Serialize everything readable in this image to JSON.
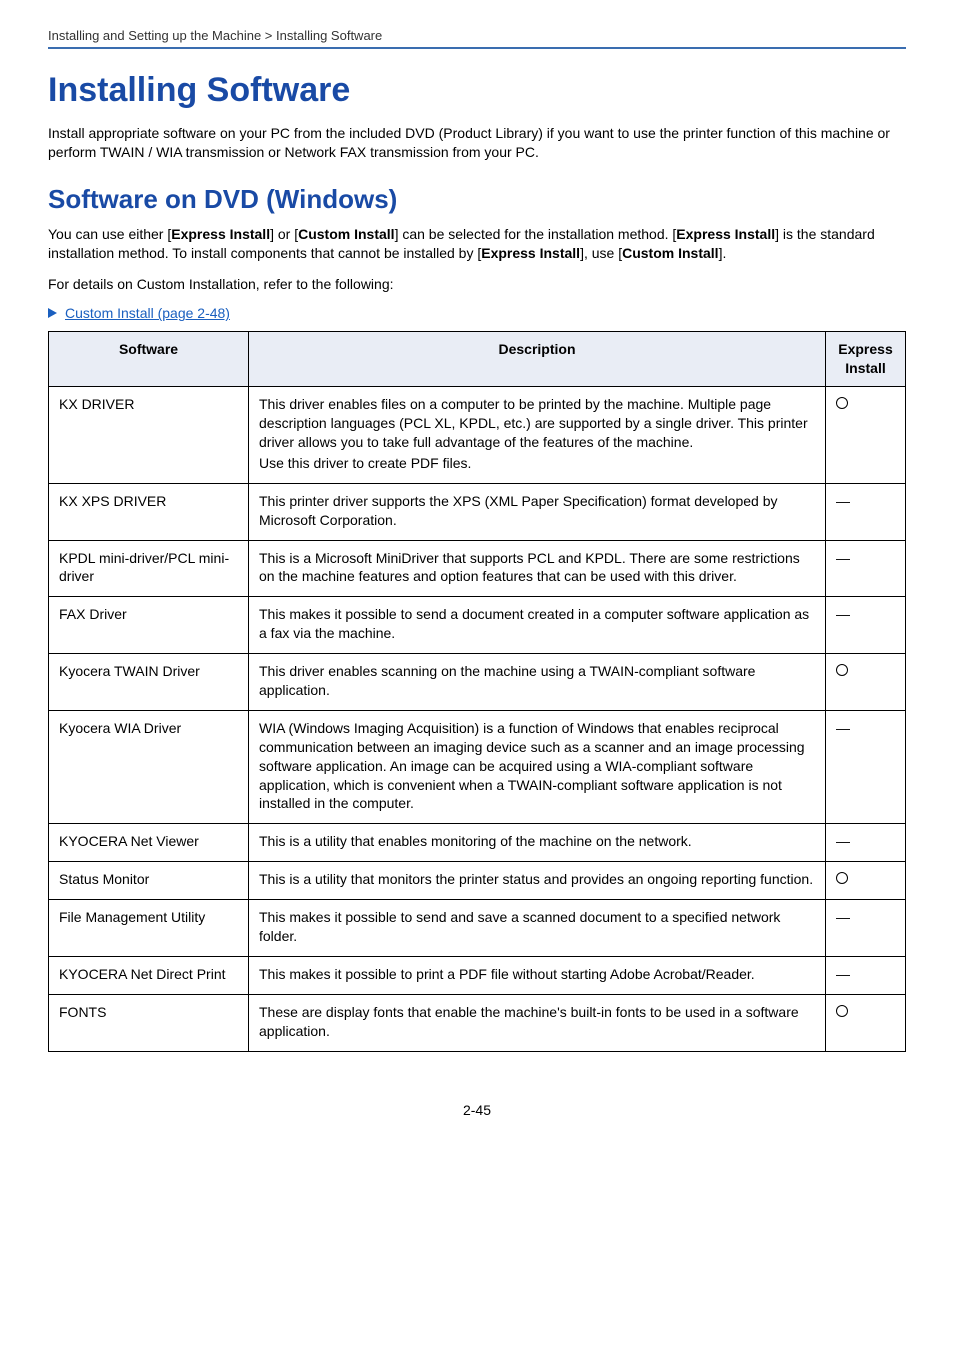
{
  "breadcrumb": "Installing and Setting up the Machine > Installing Software",
  "h1": "Installing Software",
  "intro": "Install appropriate software on your PC from the included DVD (Product Library) if you want to use the printer function of this machine or perform TWAIN / WIA transmission or Network FAX transmission from your PC.",
  "h2": "Software on DVD (Windows)",
  "para2_pre": "You can use either [",
  "para2_b1": "Express Install",
  "para2_mid1": "] or [",
  "para2_b2": "Custom Install",
  "para2_mid2": "] can be selected for the installation method. [",
  "para2_b3": "Express Install",
  "para2_mid3": "] is the standard installation method. To install components that cannot be installed by [",
  "para2_b4": "Express Install",
  "para2_mid4": "], use [",
  "para2_b5": "Custom Install",
  "para2_post": "].",
  "para3": "For details on Custom Installation, refer to the following:",
  "crossref": "Custom Install (page 2-48)",
  "table": {
    "headers": {
      "software": "Software",
      "description": "Description",
      "express": "Express Install"
    },
    "rows": [
      {
        "software": "KX DRIVER",
        "desc1": "This driver enables files on a computer to be printed by the machine. Multiple page description languages (PCL XL, KPDL, etc.) are supported by a single driver. This printer driver allows you to take full advantage of the features of the machine.",
        "desc2": "Use this driver to create PDF files.",
        "express": "circle"
      },
      {
        "software": "KX XPS DRIVER",
        "desc1": "This printer driver supports the XPS (XML Paper Specification) format developed by Microsoft Corporation.",
        "express": "—"
      },
      {
        "software": "KPDL mini-driver/PCL mini-driver",
        "desc1": "This is a Microsoft MiniDriver that supports PCL and KPDL. There are some restrictions on the machine features and option features that can be used with this driver.",
        "express": "—"
      },
      {
        "software": "FAX Driver",
        "desc1": "This makes it possible to send a document created in a computer software application as a fax via the machine.",
        "express": "—"
      },
      {
        "software": "Kyocera TWAIN Driver",
        "desc1": "This driver enables scanning on the machine using a TWAIN-compliant software application.",
        "express": "circle"
      },
      {
        "software": "Kyocera WIA Driver",
        "desc1": "WIA (Windows Imaging Acquisition) is a function of Windows that enables reciprocal communication between an imaging device such as a scanner and an image processing software application. An image can be acquired using a WIA-compliant software application, which is convenient when a TWAIN-compliant software application is not installed in the computer.",
        "express": "—"
      },
      {
        "software": "KYOCERA Net Viewer",
        "desc1": "This is a utility that enables monitoring of the machine on the network.",
        "express": "—"
      },
      {
        "software": "Status Monitor",
        "desc1": "This is a utility that monitors the printer status and provides an ongoing reporting function.",
        "express": "circle"
      },
      {
        "software": "File Management Utility",
        "desc1": "This makes it possible to send and save a scanned document to a specified network folder.",
        "express": "—"
      },
      {
        "software": "KYOCERA Net Direct Print",
        "desc1": "This makes it possible to print a PDF file without starting Adobe Acrobat/Reader.",
        "express": "—"
      },
      {
        "software": "FONTS",
        "desc1": "These are display fonts that enable the machine's built-in fonts to be used in a software application.",
        "express": "circle"
      }
    ]
  },
  "pagenum": "2-45"
}
